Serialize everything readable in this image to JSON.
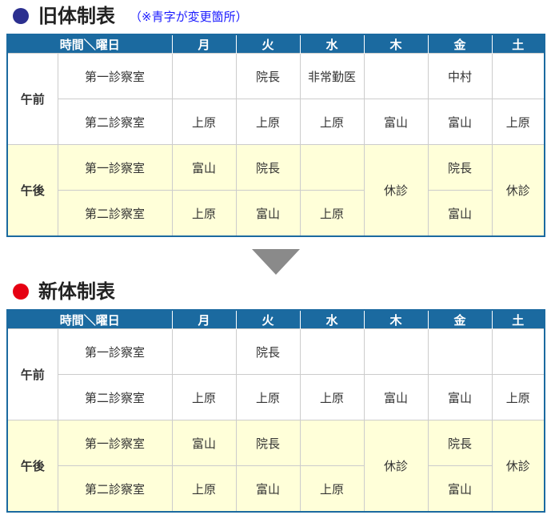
{
  "old": {
    "title": "旧体制表",
    "note": "（※青字が変更箇所）",
    "header": [
      "時間＼曜日",
      "月",
      "火",
      "水",
      "木",
      "金",
      "土"
    ],
    "am_label": "午前",
    "pm_label": "午後",
    "rows": {
      "am1": {
        "room": "第一診察室",
        "mon": "",
        "tue": "院長",
        "wed": "非常勤医",
        "thu": "",
        "fri": "中村",
        "sat": ""
      },
      "am2": {
        "room": "第二診察室",
        "mon": "上原",
        "tue": "上原",
        "wed": "上原",
        "thu": "富山",
        "fri": "富山",
        "sat": "上原"
      },
      "pm1": {
        "room": "第一診察室",
        "mon": "富山",
        "tue": "院長",
        "wed": "",
        "thu": "休診",
        "fri": "院長",
        "sat": "休診"
      },
      "pm2": {
        "room": "第二診察室",
        "mon": "上原",
        "tue": "富山",
        "wed": "上原",
        "fri": "富山"
      }
    }
  },
  "new": {
    "title": "新体制表",
    "header": [
      "時間＼曜日",
      "月",
      "火",
      "水",
      "木",
      "金",
      "土"
    ],
    "am_label": "午前",
    "pm_label": "午後",
    "rows": {
      "am1": {
        "room": "第一診察室",
        "mon": "",
        "tue": "院長",
        "wed": "",
        "thu": "",
        "fri": "",
        "sat": ""
      },
      "am2": {
        "room": "第二診察室",
        "mon": "上原",
        "tue": "上原",
        "wed": "上原",
        "thu": "富山",
        "fri": "富山",
        "sat": "上原"
      },
      "pm1": {
        "room": "第一診察室",
        "mon": "富山",
        "tue": "院長",
        "wed": "",
        "thu": "休診",
        "fri": "院長",
        "sat": "休診"
      },
      "pm2": {
        "room": "第二診察室",
        "mon": "上原",
        "tue": "富山",
        "wed": "上原",
        "fri": "富山"
      }
    }
  },
  "colors": {
    "header_bg": "#1b6aa0",
    "pm_bg": "#ffffd9",
    "changed": "#1a1aff",
    "closed": "#cc0000"
  }
}
